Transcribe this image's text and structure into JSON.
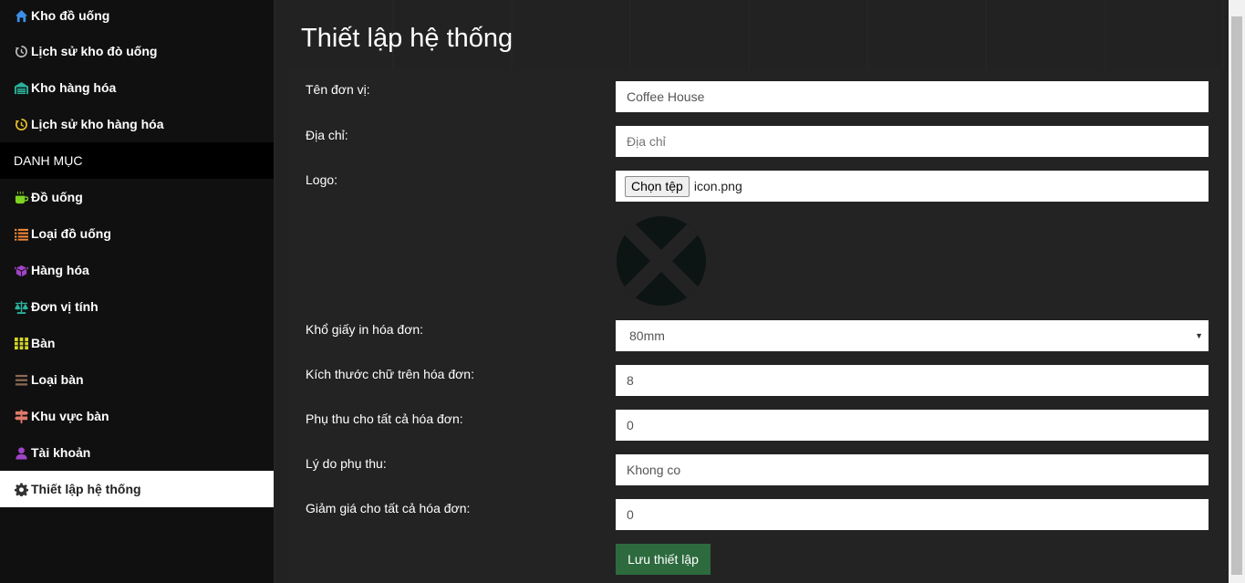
{
  "sidebar": {
    "items_top": [
      {
        "label": "Kho đồ uống",
        "icon": "home-icon",
        "color": "#3b8fe6"
      },
      {
        "label": "Lịch sử kho đò uống",
        "icon": "history-icon",
        "color": "#bbbbbb"
      },
      {
        "label": "Kho hàng hóa",
        "icon": "warehouse-icon",
        "color": "#2ab19a"
      },
      {
        "label": "Lịch sử kho hàng hóa",
        "icon": "history-icon",
        "color": "#e6c12a"
      }
    ],
    "section_label": "DANH MỤC",
    "items_bottom": [
      {
        "label": "Đồ uống",
        "icon": "coffee-icon",
        "color": "#7ed321"
      },
      {
        "label": "Loại đồ uống",
        "icon": "list-icon",
        "color": "#f0883a"
      },
      {
        "label": "Hàng hóa",
        "icon": "box-icon",
        "color": "#a044c8"
      },
      {
        "label": "Đơn vị tính",
        "icon": "scale-icon",
        "color": "#2ab19a"
      },
      {
        "label": "Bàn",
        "icon": "grid-icon",
        "color": "#d6d62a"
      },
      {
        "label": "Loại bàn",
        "icon": "bars-icon",
        "color": "#8a6a55"
      },
      {
        "label": "Khu vực bàn",
        "icon": "signpost-icon",
        "color": "#e07a6a"
      },
      {
        "label": "Tài khoản",
        "icon": "user-icon",
        "color": "#a044c8"
      }
    ],
    "active_item": {
      "label": "Thiết lập hệ thống",
      "icon": "gear-icon",
      "color": "#333333"
    }
  },
  "main": {
    "title": "Thiết lập hệ thống",
    "form": {
      "unit_name": {
        "label": "Tên đơn vị:",
        "value": "Coffee House"
      },
      "address": {
        "label": "Địa chỉ:",
        "placeholder": "Địa chỉ"
      },
      "logo": {
        "label": "Logo:",
        "button_label": "Chọn tệp",
        "file_name": "icon.png"
      },
      "paper_size": {
        "label": "Khổ giấy in hóa đơn:",
        "value": "80mm"
      },
      "font_size": {
        "label": "Kích thước chữ trên hóa đơn:",
        "value": "8"
      },
      "surcharge": {
        "label": "Phụ thu cho tất cả hóa đơn:",
        "value": "0"
      },
      "surcharge_reason": {
        "label": "Lý do phụ thu:",
        "value": "Khong co"
      },
      "discount": {
        "label": "Giảm giá cho tất cả hóa đơn:",
        "value": "0"
      },
      "save_label": "Lưu thiết lập"
    }
  }
}
